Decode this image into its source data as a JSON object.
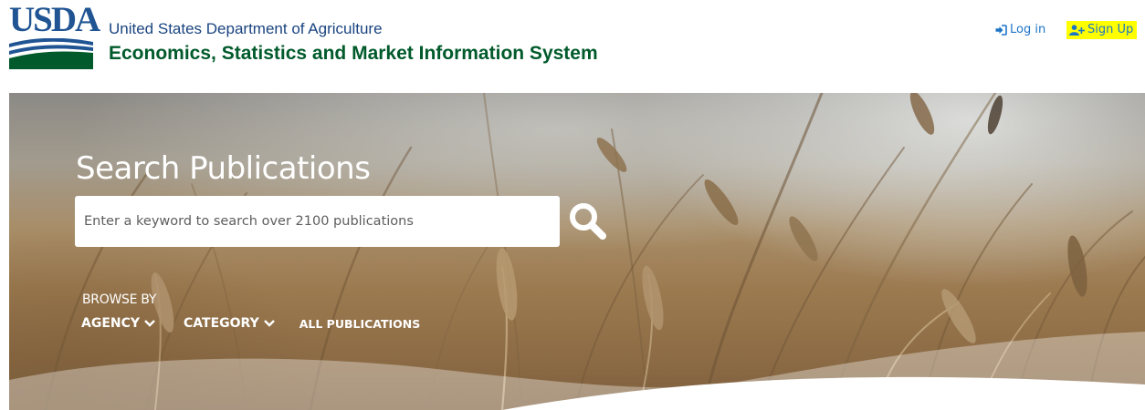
{
  "header": {
    "logo_text": "USDA",
    "org_name": "United States Department of Agriculture",
    "system_name": "Economics, Statistics and Market Information System",
    "login_label": "Log in",
    "signup_label": "Sign Up",
    "login_icon": "sign-in-icon",
    "signup_icon": "user-plus-icon",
    "signup_highlight_color": "#ffff00",
    "link_color": "#1c74c7",
    "brand_blue": "#205493",
    "brand_green": "#005a2b"
  },
  "hero": {
    "title": "Search Publications",
    "search": {
      "placeholder": "Enter a keyword to search over 2100 publications",
      "value": "",
      "icon": "search-icon"
    },
    "browse": {
      "label": "BROWSE BY",
      "items": [
        {
          "label": "AGENCY",
          "has_dropdown": true
        },
        {
          "label": "CATEGORY",
          "has_dropdown": true
        },
        {
          "label": "ALL PUBLICATIONS",
          "has_dropdown": false
        }
      ]
    }
  }
}
